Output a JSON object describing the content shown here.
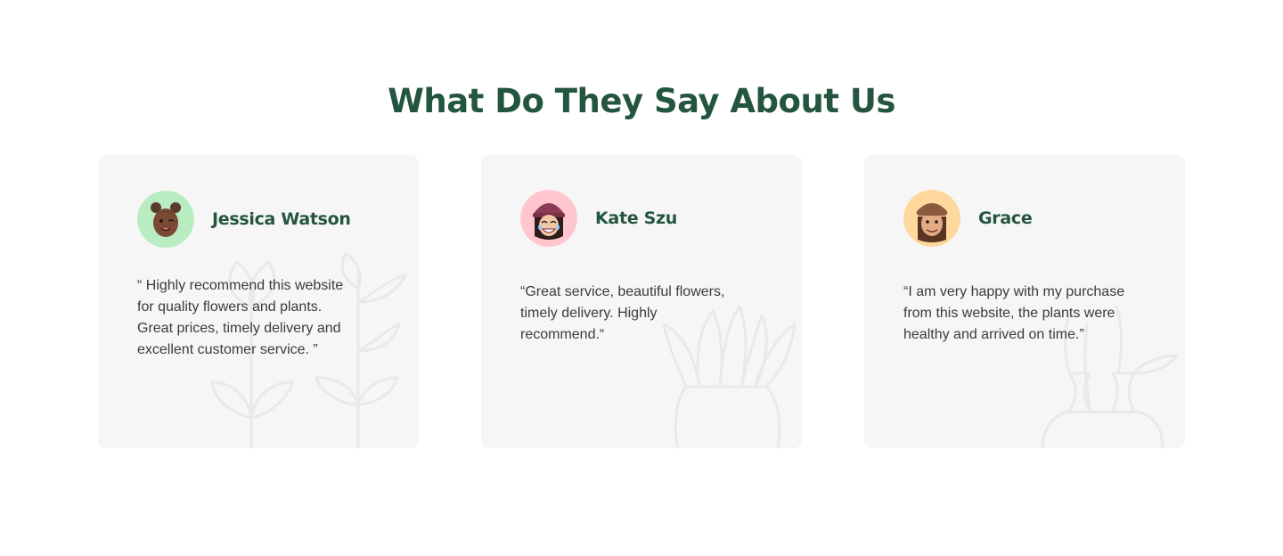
{
  "section": {
    "title": "What Do They Say About Us"
  },
  "testimonials": [
    {
      "name": "Jessica Watson",
      "quote": "“ Highly recommend this website for quality flowers and plants. Great prices, timely delivery and excellent customer service. ”",
      "avatar_color": "#b9ecc0",
      "avatar_icon": "memoji-avatar-icon"
    },
    {
      "name": "Kate Szu",
      "quote": "“Great service, beautiful flowers, timely delivery. Highly recommend.“",
      "avatar_color": "#ffc6cf",
      "avatar_icon": "memoji-avatar-icon"
    },
    {
      "name": "Grace",
      "quote": "“I am very happy with my purchase from this website, the plants were healthy and arrived on time.”",
      "avatar_color": "#ffd89e",
      "avatar_icon": "memoji-avatar-icon"
    }
  ],
  "colors": {
    "brand_green": "#24553f",
    "card_bg": "#f6f6f6",
    "text": "#3b3b3b"
  }
}
